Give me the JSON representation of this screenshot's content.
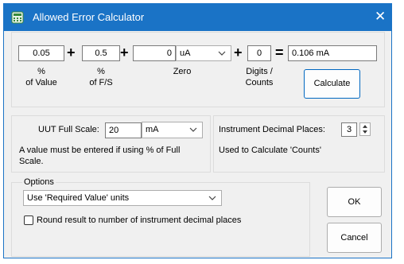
{
  "window": {
    "title": "Allowed Error Calculator",
    "close_glyph": "✕",
    "icon": "calculator-icon",
    "accent": "#1a73c6"
  },
  "calc": {
    "percent_value": "0.05",
    "plus1": "+",
    "percent_fs": "0.5",
    "plus2": "+",
    "zero_value": "0",
    "zero_unit": "uA",
    "plus3": "+",
    "digits_value": "0",
    "equals": "=",
    "result": "0.106 mA",
    "label_percent": "%",
    "label_of_value": "of Value",
    "label_percent2": "%",
    "label_of_fs": "of F/S",
    "label_zero": "Zero",
    "label_digits": "Digits /",
    "label_counts": "Counts",
    "calculate_label": "Calculate"
  },
  "uut": {
    "full_scale_label": "UUT Full Scale:",
    "full_scale_value": "20",
    "unit": "mA",
    "note_line1": "A value must be entered if using % of Full",
    "note_line2": "Scale."
  },
  "instrument": {
    "label": "Instrument Decimal Places:",
    "value": "3",
    "note": "Used to Calculate 'Counts'"
  },
  "options": {
    "title": "Options",
    "units_selected": "Use 'Required Value' units",
    "round_label": "Round result to number of instrument decimal places"
  },
  "actions": {
    "ok_label": "OK",
    "cancel_label": "Cancel"
  }
}
